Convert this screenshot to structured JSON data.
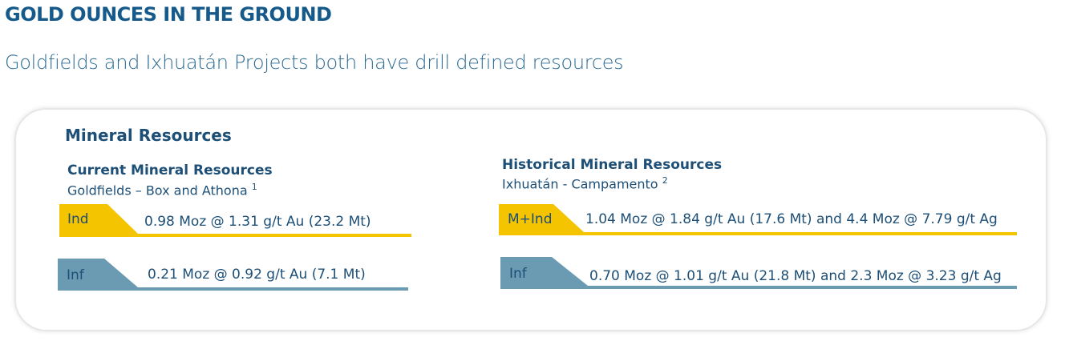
{
  "header": {
    "title": "GOLD OUNCES IN THE GROUND",
    "subtitle": "Goldfields and Ixhuatán Projects both have drill defined resources"
  },
  "card": {
    "heading": "Mineral Resources",
    "current": {
      "title": "Current Mineral Resources",
      "project": "Goldfields – Box and Athona",
      "footnote": "1",
      "rows": [
        {
          "category": "Ind",
          "value": "0.98 Moz @ 1.31 g/t Au (23.2 Mt)",
          "color": "#f5c400"
        },
        {
          "category": "Inf",
          "value": "0.21 Moz @ 0.92 g/t Au (7.1 Mt)",
          "color": "#6a9bb2"
        }
      ]
    },
    "historical": {
      "title": "Historical Mineral Resources",
      "project": "Ixhuatán - Campamento",
      "footnote": "2",
      "rows": [
        {
          "category": "M+Ind",
          "value": "1.04 Moz @ 1.84 g/t Au (17.6 Mt) and 4.4 Moz @ 7.79 g/t Ag",
          "color": "#f5c400"
        },
        {
          "category": "Inf",
          "value": "0.70 Moz @ 1.01 g/t Au (21.8 Mt) and 2.3 Moz @ 3.23 g/t Ag",
          "color": "#6a9bb2"
        }
      ]
    }
  }
}
